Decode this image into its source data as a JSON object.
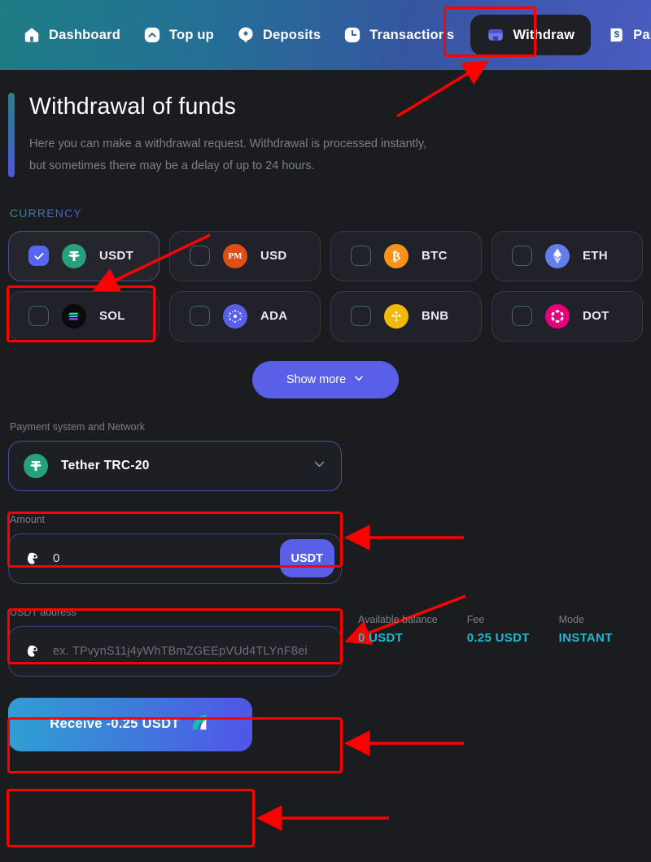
{
  "nav": {
    "items": [
      {
        "label": "Dashboard",
        "icon": "home-icon",
        "active": false
      },
      {
        "label": "Top up",
        "icon": "chevron-up-icon",
        "active": false
      },
      {
        "label": "Deposits",
        "icon": "diamond-pin-icon",
        "active": false
      },
      {
        "label": "Transactions",
        "icon": "clock-icon",
        "active": false
      },
      {
        "label": "Withdraw",
        "icon": "wallet-icon",
        "active": true
      },
      {
        "label": "Partners",
        "icon": "partners-icon",
        "active": false
      }
    ]
  },
  "page": {
    "title": "Withdrawal of funds",
    "description": "Here you can make a withdrawal request. Withdrawal is processed instantly, but sometimes there may be a delay of up to 24 hours."
  },
  "currency": {
    "label": "CURRENCY",
    "options": [
      {
        "code": "USDT",
        "icon": "tether-icon",
        "selected": true
      },
      {
        "code": "USD",
        "icon": "perfectmoney-icon",
        "selected": false
      },
      {
        "code": "BTC",
        "icon": "bitcoin-icon",
        "selected": false
      },
      {
        "code": "ETH",
        "icon": "ethereum-icon",
        "selected": false
      },
      {
        "code": "SOL",
        "icon": "solana-icon",
        "selected": false
      },
      {
        "code": "ADA",
        "icon": "cardano-icon",
        "selected": false
      },
      {
        "code": "BNB",
        "icon": "binance-icon",
        "selected": false
      },
      {
        "code": "DOT",
        "icon": "polkadot-icon",
        "selected": false
      }
    ],
    "show_more_label": "Show more"
  },
  "network": {
    "label": "Payment system and Network",
    "selected": "Tether TRC-20",
    "icon": "tether-icon"
  },
  "amount": {
    "label": "Amount",
    "value": "0",
    "currency_suffix": "USDT"
  },
  "stats": [
    {
      "key": "Available balance",
      "value": "0 USDT"
    },
    {
      "key": "Fee",
      "value": "0.25 USDT"
    },
    {
      "key": "Mode",
      "value": "INSTANT"
    }
  ],
  "address": {
    "label": "USDT address",
    "placeholder": "ex. TPvynS11j4yWhTBmZGEEpVUd4TLYnF8ei",
    "value": ""
  },
  "submit": {
    "label": "Receive -0.25 USDT",
    "icon": "brand-mark-icon"
  },
  "colors": {
    "accent_purple": "#5a5fe8",
    "accent_teal": "#1fb8d4",
    "annotation_red": "#fe0000",
    "header_gradient_start": "#1e7d85",
    "header_gradient_end": "#4a5cc0"
  }
}
